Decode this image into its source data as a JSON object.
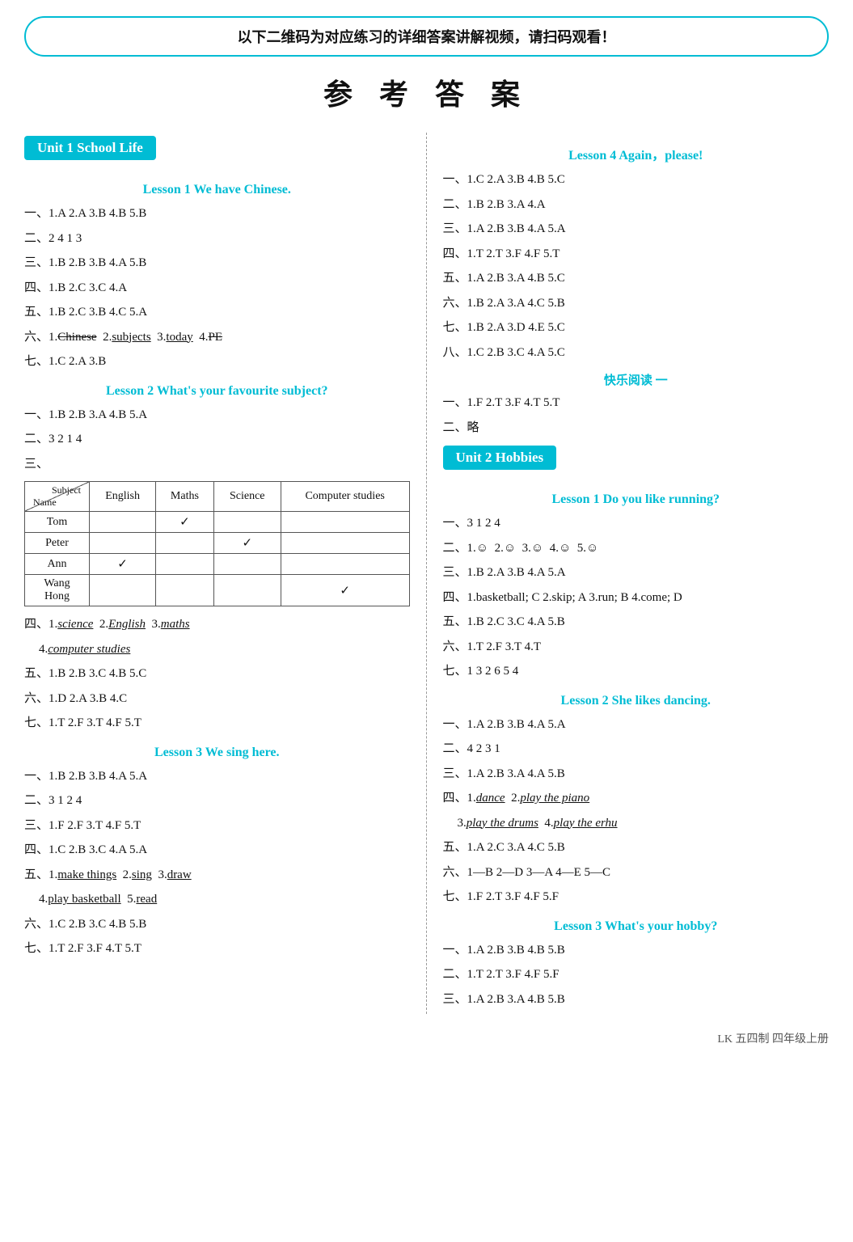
{
  "banner": "以下二维码为对应练习的详细答案讲解视频，请扫码观看！",
  "mainTitle": "参 考 答 案",
  "left": {
    "unit1": {
      "header": "Unit 1   School Life",
      "lesson1": {
        "title": "Lesson 1   We have Chinese.",
        "rows": [
          "一、1.A  2.A  3.B  4.B  5.B",
          "二、2  4  1  3",
          "三、1.B  2.B  3.B  4.A  5.B",
          "四、1.B  2.C  3.C  4.A",
          "五、1.B  2.C  3.B  4.C  5.A"
        ],
        "row6_prefix": "六、1.",
        "row6_items": [
          {
            "text": "Chinese",
            "style": "strikethrough"
          },
          {
            "prefix": " 2.",
            "text": "subjects",
            "style": "underline"
          },
          {
            "prefix": " 3.",
            "text": "today",
            "style": "underline"
          },
          {
            "prefix": " 4.",
            "text": "PE",
            "style": "strikethrough"
          }
        ],
        "row7": "七、1.C  2.A  3.B"
      },
      "lesson2": {
        "title": "Lesson 2   What's your favourite subject?",
        "rows": [
          "一、1.B  2.B  3.A  4.B  5.A",
          "二、3  2  1  4",
          "三、"
        ],
        "table": {
          "headers": [
            "Subject",
            "English",
            "Maths",
            "Science",
            "Computer studies"
          ],
          "nameLabel": "Name",
          "rows": [
            {
              "name": "Tom",
              "english": "",
              "maths": "✓",
              "science": "",
              "computer": ""
            },
            {
              "name": "Peter",
              "english": "",
              "maths": "",
              "science": "✓",
              "computer": ""
            },
            {
              "name": "Ann",
              "english": "✓",
              "maths": "",
              "science": "",
              "computer": ""
            },
            {
              "name": "Wang Hong",
              "english": "",
              "maths": "",
              "science": "",
              "computer": "✓"
            }
          ]
        },
        "row4_prefix": "四、1.",
        "row4_items": [
          {
            "text": "science",
            "style": "underline-italic"
          },
          {
            "prefix": " 2.",
            "text": "English",
            "style": "underline-italic"
          },
          {
            "prefix": " 3.",
            "text": "maths",
            "style": "underline-italic"
          }
        ],
        "row4b_prefix": "    4.",
        "row4b_items": [
          {
            "text": "computer studies",
            "style": "underline-italic"
          }
        ],
        "rows2": [
          "五、1.B  2.B  3.C  4.B  5.C",
          "六、1.D  2.A  3.B  4.C",
          "七、1.T  2.F  3.T  4.F  5.T"
        ]
      },
      "lesson3": {
        "title": "Lesson 3   We sing here.",
        "rows": [
          "一、1.B  2.B  3.B  4.A  5.A",
          "二、3  1  2  4",
          "三、1.F  2.F  3.T  4.F  5.T",
          "四、1.C  2.B  3.C  4.A  5.A"
        ],
        "row5_prefix": "五、1.",
        "row5_items": [
          {
            "text": "make things",
            "style": "underline"
          },
          {
            "prefix": " 2.",
            "text": "sing",
            "style": "underline"
          },
          {
            "prefix": " 3.",
            "text": "draw",
            "style": "underline"
          }
        ],
        "row5b_prefix": "    4.",
        "row5b_items": [
          {
            "text": "play basketball",
            "style": "underline"
          },
          {
            "prefix": " 5.",
            "text": "read",
            "style": "underline"
          }
        ],
        "rows2": [
          "六、1.C  2.B  3.C  4.B  5.B",
          "七、1.T  2.F  3.F  4.T  5.T"
        ]
      }
    }
  },
  "right": {
    "lesson4": {
      "title": "Lesson 4   Again，please!",
      "rows": [
        "一、1.C  2.A  3.B  4.B  5.C",
        "二、1.B  2.B  3.A  4.A",
        "三、1.A  2.B  3.B  4.A  5.A",
        "四、1.T  2.T  3.F  4.F  5.T",
        "五、1.A  2.B  3.A  4.B  5.C",
        "六、1.B  2.A  3.A  4.C  5.B",
        "七、1.B  2.A  3.D  4.E  5.C",
        "八、1.C  2.B  3.C  4.A  5.C"
      ]
    },
    "kuaile": {
      "label": "快乐阅读 一",
      "rows": [
        "一、1.F  2.T  3.F  4.T  5.T",
        "二、略"
      ]
    },
    "unit2": {
      "header": "Unit 2   Hobbies",
      "lesson1": {
        "title": "Lesson 1   Do you like running?",
        "rows": [
          "一、3  1  2  4"
        ],
        "row2": "二、1.😊  2.😊  3.😊  4.😊  5.😊",
        "rows2": [
          "三、1.B  2.A  3.B  4.A  5.A",
          "四、1.basketball; C  2.skip; A  3.run; B  4.come; D",
          "五、1.B  2.C  3.C  4.A  5.B",
          "六、1.T  2.F  3.T  4.T",
          "七、1  3  2  6  5  4"
        ]
      },
      "lesson2": {
        "title": "Lesson 2   She likes dancing.",
        "rows": [
          "一、1.A  2.B  3.B  4.A  5.A",
          "二、4  2  3  1",
          "三、1.A  2.B  3.A  4.A  5.B"
        ],
        "row4_prefix": "四、1.",
        "row4_items": [
          {
            "text": "dance",
            "style": "underline-italic"
          },
          {
            "prefix": " 2.",
            "text": "play the piano",
            "style": "underline-italic"
          }
        ],
        "row4b_prefix": "    3.",
        "row4b_items": [
          {
            "text": "play the drums",
            "style": "underline-italic"
          },
          {
            "prefix": " 4.",
            "text": "play the erhu",
            "style": "underline-italic"
          }
        ],
        "rows2": [
          "五、1.A  2.C  3.A  4.C  5.B",
          "六、1—B  2—D  3—A  4—E  5—C",
          "七、1.F  2.T  3.F  4.F  5.F"
        ]
      },
      "lesson3": {
        "title": "Lesson 3   What's your hobby?",
        "rows": [
          "一、1.A  2.B  3.B  4.B  5.B",
          "二、1.T  2.T  3.F  4.F  5.F",
          "三、1.A  2.B  3.A  4.B  5.B"
        ]
      }
    }
  },
  "footer": "LK 五四制 四年级上册"
}
